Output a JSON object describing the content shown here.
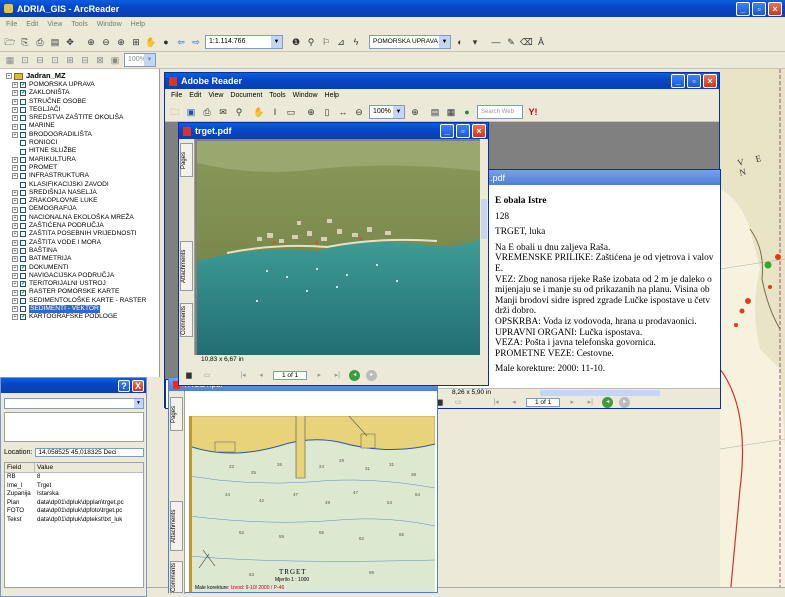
{
  "arcreader": {
    "title": "ADRIA_GIS - ArcReader",
    "menu": [
      "File",
      "Edit",
      "View",
      "Tools",
      "Window",
      "Help"
    ],
    "scale": "1:1.114.766",
    "layer_combo": "POMORSKA UPRAVA",
    "zoom_combo": "100%"
  },
  "toc": {
    "root": "Jadran_MZ",
    "layers": [
      {
        "label": "POMORSKA UPRAVA",
        "checked": true,
        "expand": true
      },
      {
        "label": "ZAKLONIŠTA",
        "checked": true,
        "expand": true
      },
      {
        "label": "STRUČNE OSOBE",
        "checked": false,
        "expand": true
      },
      {
        "label": "TEGLJAČI",
        "checked": false,
        "expand": true
      },
      {
        "label": "SREDSTVA ZAŠTITE OKOLIŠA",
        "checked": false,
        "expand": true
      },
      {
        "label": "MARINE",
        "checked": false,
        "expand": true
      },
      {
        "label": "BRODOGRADILIŠTA",
        "checked": false,
        "expand": true
      },
      {
        "label": "RONIOCI",
        "checked": false,
        "expand": false
      },
      {
        "label": "HITNE SLUŽBE",
        "checked": false,
        "expand": false
      },
      {
        "label": "MARIKULTURA",
        "checked": false,
        "expand": true
      },
      {
        "label": "PROMET",
        "checked": false,
        "expand": true
      },
      {
        "label": "INFRASTRUKTURA",
        "checked": false,
        "expand": true
      },
      {
        "label": "KLASIFIKACIJSKI ZAVODI",
        "checked": false,
        "expand": false
      },
      {
        "label": "SREDIŠNJA NASELJA",
        "checked": false,
        "expand": true
      },
      {
        "label": "ZRAKOPLOVNE LUKE",
        "checked": false,
        "expand": true
      },
      {
        "label": "DEMOGRAFIJA",
        "checked": false,
        "expand": true
      },
      {
        "label": "NACIONALNA EKOLOŠKA MREŽA",
        "checked": false,
        "expand": true
      },
      {
        "label": "ZAŠTIĆENA PODRUČJA",
        "checked": false,
        "expand": true
      },
      {
        "label": "ZAŠTITA POSEBNIH VRIJEDNOSTI",
        "checked": false,
        "expand": true
      },
      {
        "label": "ZAŠTITA VODE I MORA",
        "checked": false,
        "expand": true
      },
      {
        "label": "BAŠTINA",
        "checked": false,
        "expand": true
      },
      {
        "label": "BATIMETRIJA",
        "checked": false,
        "expand": true
      },
      {
        "label": "DOKUMENTI",
        "checked": true,
        "expand": true
      },
      {
        "label": "NAVIGACIJSKA PODRUČJA",
        "checked": false,
        "expand": true
      },
      {
        "label": "TERITORIJALNI USTROJ",
        "checked": true,
        "expand": true
      },
      {
        "label": "RASTER POMORSKE KARTE",
        "checked": true,
        "expand": true
      },
      {
        "label": "SEDIMENTOLOŠKE KARTE - RASTER",
        "checked": false,
        "expand": true
      },
      {
        "label": "SEDIMENTI - VEKTOR",
        "checked": false,
        "expand": true,
        "selected": true
      },
      {
        "label": "KARTOGRAFSKE PODLOGE",
        "checked": true,
        "expand": true
      }
    ]
  },
  "identify": {
    "help_btn": "?",
    "close_btn": "X",
    "location_label": "Location:",
    "location_value": "14,058525  45,018325 Deci",
    "columns": [
      "Field",
      "Value"
    ],
    "rows": [
      [
        "RB",
        "8"
      ],
      [
        "Ime_l",
        "Trget"
      ],
      [
        "Zupanija",
        "Istarska"
      ],
      [
        "Plan",
        "data\\dp01\\dpluk\\dpplan\\trget.pc"
      ],
      [
        "FOTO",
        "data\\dp01\\dpluk\\dpfoto\\trget.pc"
      ],
      [
        "Tekst",
        "data\\dp01\\dpluk\\dptekst\\txt_luk"
      ]
    ]
  },
  "adobe": {
    "title": "Adobe Reader",
    "menu": [
      "File",
      "Edit",
      "View",
      "Document",
      "Tools",
      "Window",
      "Help"
    ],
    "zoom": "100%",
    "search_placeholder": "Search Web"
  },
  "photo_pdf": {
    "title": "trget.pdf",
    "size": "10,83 x 6,67 in",
    "page": "1 of 1"
  },
  "text_pdf": {
    "title": ".pdf",
    "size": "8,26 x 5,90 in",
    "page": "1 of 1",
    "lines": [
      {
        "text": "E obala Istre",
        "bold": true
      },
      {
        "text": "128",
        "gap": true
      },
      {
        "text": "TRGET, luka",
        "gap": true
      },
      {
        "text": "Na E obali u dnu zaljeva Raša.",
        "gap": true
      },
      {
        "text": "VREMENSKE PRILIKE: Zaštićena je od vjetrova i valov"
      },
      {
        "text": "E."
      },
      {
        "text": "VEZ: Zbog nanosa rijeke Raše izobata od 2 m je daleko o"
      },
      {
        "text": "mijenjaju se i manje su od prikazanih na planu. Visina ob"
      },
      {
        "text": "Manji brodovi sidre ispred zgrade Lučke ispostave u četv"
      },
      {
        "text": "drži dobro."
      },
      {
        "text": "OPSKRBA: Voda iz vodovoda, hrana u prodavaonici."
      },
      {
        "text": "UPRAVNI ORGANI: Lučka ispostava."
      },
      {
        "text": "VEZA: Pošta i javna telefonska govornica."
      },
      {
        "text": "PROMETNE VEZE: Cestovne."
      },
      {
        "text": "Male korekture: 2000: 11-10.",
        "gap": true
      }
    ]
  },
  "plan_pdf": {
    "title": "TRGET.pdf",
    "chart_title": "TRGET",
    "chart_scale": "Mjerilo  1 : 1000",
    "footer": "Male korekture:",
    "footer_red": "Izvod: 9-10/ 2000 / P-46"
  },
  "tabs": {
    "pages": "Pages",
    "attachments": "Attachments",
    "comments": "Comments"
  },
  "map_label": "V E N",
  "colors": {
    "xp_blue": "#0a4fd0",
    "sea": "#2a8d8a",
    "chart_paper": "#f4f1dc"
  }
}
